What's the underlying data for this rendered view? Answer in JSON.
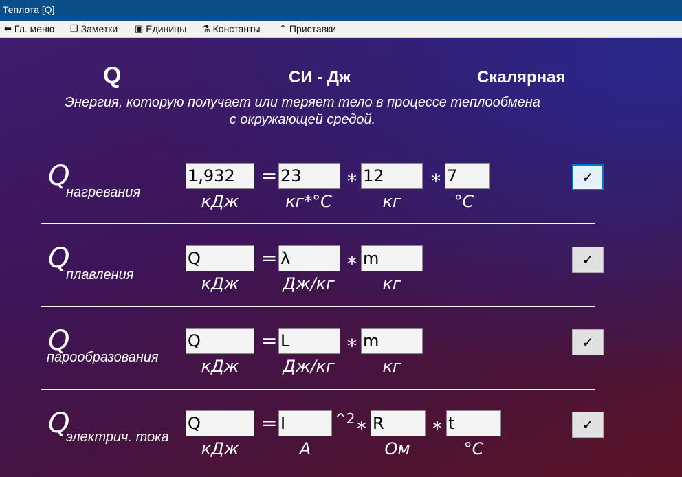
{
  "window": {
    "title": "Теплота [Q]"
  },
  "menu": [
    {
      "label": "Гл. меню",
      "icon": "arrow-back-icon"
    },
    {
      "label": "Заметки",
      "icon": "notes-icon"
    },
    {
      "label": "Единицы",
      "icon": "book-icon"
    },
    {
      "label": "Константы",
      "icon": "link-icon"
    },
    {
      "label": "Приставки",
      "icon": "caret-up-icon"
    }
  ],
  "header": {
    "symbol": "Q",
    "units": "СИ - Дж",
    "type": "Скалярная",
    "description_line1": "Энергия, которую получает или теряет тело в процессе теплообмена",
    "description_line2": "с окружающей средой."
  },
  "rows": [
    {
      "symbol": "Q",
      "subscript": "нагревания",
      "result": {
        "value": "1,932",
        "unit": "кДж"
      },
      "fields": [
        {
          "value": "23",
          "unit": "кг*°С"
        },
        {
          "value": "12",
          "unit": "кг"
        },
        {
          "value": "7",
          "unit": "°С"
        }
      ]
    },
    {
      "symbol": "Q",
      "subscript": "плавления",
      "result": {
        "value": "Q",
        "unit": "кДж"
      },
      "fields": [
        {
          "value": "λ",
          "unit": "Дж/кг"
        },
        {
          "value": "m",
          "unit": "кг"
        }
      ]
    },
    {
      "symbol": "Q",
      "subscript": "парообразования",
      "result": {
        "value": "Q",
        "unit": "кДж"
      },
      "fields": [
        {
          "value": "L",
          "unit": "Дж/кг"
        },
        {
          "value": "m",
          "unit": "кг"
        }
      ]
    },
    {
      "symbol": "Q",
      "subscript": "электрич. тока",
      "result": {
        "value": "Q",
        "unit": "кДж"
      },
      "power": "^2",
      "fields": [
        {
          "value": "I",
          "unit": "А"
        },
        {
          "value": "R",
          "unit": "Ом"
        },
        {
          "value": "t",
          "unit": "°С"
        }
      ]
    }
  ],
  "operators": {
    "equals": "=",
    "multiply": "*"
  },
  "check_glyph": "✓"
}
